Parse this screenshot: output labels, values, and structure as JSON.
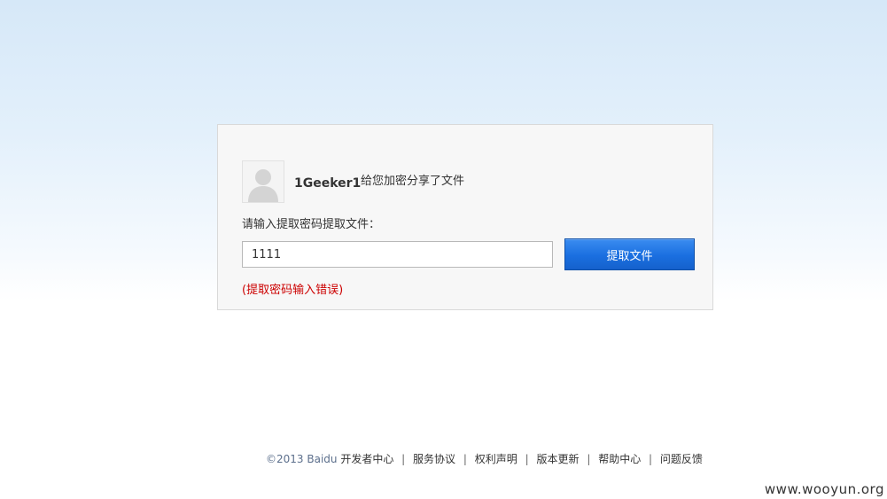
{
  "share": {
    "username": "1Geeker1",
    "message": "给您加密分享了文件"
  },
  "form": {
    "prompt_label": "请输入提取密码提取文件：",
    "code_value": "1111",
    "submit_label": "提取文件",
    "error_message": "(提取密码输入错误)"
  },
  "footer": {
    "copyright": "©2013 Baidu",
    "links": [
      "开发者中心",
      "服务协议",
      "权利声明",
      "版本更新",
      "帮助中心",
      "问题反馈"
    ]
  },
  "watermark": "www.wooyun.org",
  "colors": {
    "button_blue": "#1a6fe0",
    "error_red": "#cc0000"
  },
  "icons": {
    "avatar": "default-user-avatar-icon"
  }
}
